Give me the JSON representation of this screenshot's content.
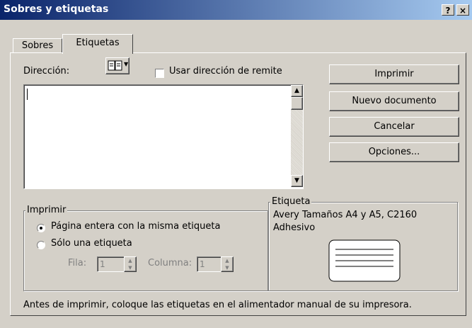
{
  "window": {
    "title": "Sobres y etiquetas",
    "help_glyph": "?",
    "close_glyph": "×"
  },
  "tabs": [
    {
      "label": "Sobres",
      "selected": false
    },
    {
      "label": "Etiquetas",
      "selected": true
    }
  ],
  "address": {
    "label": "Dirección:",
    "value": "",
    "book_icon": "address-book-icon",
    "use_return_address_label": "Usar dirección de remite",
    "use_return_address_checked": false
  },
  "buttons": {
    "print": "Imprimir",
    "new_document": "Nuevo documento",
    "cancel": "Cancelar",
    "options": "Opciones..."
  },
  "label_group": {
    "legend": "Etiqueta",
    "line1": "Avery Tamaños A4 y A5, C2160",
    "line2": "Adhesivo"
  },
  "print_group": {
    "legend": "Imprimir",
    "full_page_label": "Página entera con la misma etiqueta",
    "full_page_selected": true,
    "single_label": "Sólo una etiqueta",
    "single_selected": false,
    "row_label": "Fila:",
    "row_value": "1",
    "column_label": "Columna:",
    "column_value": "1"
  },
  "footer_note": "Antes de imprimir, coloque las etiquetas en el alimentador manual de su impresora.",
  "colors": {
    "titlebar_start": "#0a246a",
    "titlebar_end": "#a6caf0",
    "face": "#d4d0c8"
  }
}
